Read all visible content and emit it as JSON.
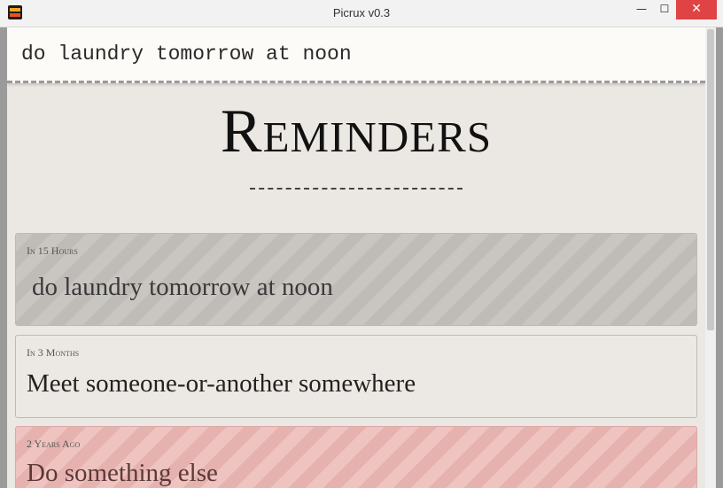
{
  "window": {
    "title": "Picrux v0.3",
    "minimize_glyph": "—",
    "maximize_glyph": "☐",
    "close_glyph": "✕"
  },
  "input": {
    "value": "do laundry tomorrow at noon"
  },
  "page": {
    "title": "Reminders"
  },
  "reminders": [
    {
      "when": "In 15 Hours",
      "text": "do laundry tomorrow at noon",
      "state": "pending"
    },
    {
      "when": "In 3 Months",
      "text": "Meet someone-or-another somewhere",
      "state": "future"
    },
    {
      "when": "2 Years Ago",
      "text": "Do something else",
      "state": "overdue"
    }
  ],
  "colors": {
    "pending": "#c9c6c2",
    "future": "#ece9e4",
    "overdue": "#efc3c0",
    "close_button": "#e04343"
  }
}
